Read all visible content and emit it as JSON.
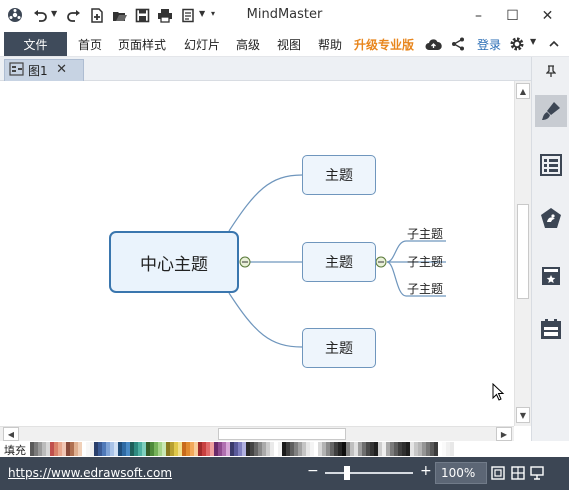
{
  "app": {
    "title": "MindMaster"
  },
  "toolbar": {
    "icons": [
      "app-logo-icon",
      "undo-icon",
      "redo-icon",
      "new-icon",
      "open-icon",
      "save-icon",
      "print-icon",
      "export-icon",
      "customize-icon"
    ]
  },
  "window_controls": {
    "minimize": "–",
    "maximize": "☐",
    "close": "✕"
  },
  "menu": {
    "file": "文件",
    "items": [
      "首页",
      "页面样式",
      "幻灯片",
      "高级",
      "视图",
      "帮助"
    ],
    "upgrade": "升级专业版",
    "login": "登录"
  },
  "tab": {
    "label": "图1",
    "close": "✕"
  },
  "mindmap": {
    "central": "中心主题",
    "topics": [
      "主题",
      "主题",
      "主题"
    ],
    "subtopics": [
      "子主题",
      "子主题",
      "子主题"
    ]
  },
  "right_panel": {
    "items": [
      "format-brush-icon",
      "outline-list-icon",
      "clipart-icon",
      "mark-icon",
      "task-calendar-icon"
    ]
  },
  "palette": {
    "fill_label": "填充",
    "colors": [
      "#5a5a5a",
      "#7a7a7a",
      "#9a9a9a",
      "#bbbbbb",
      "#d8d8d8",
      "#c0504d",
      "#d9826a",
      "#e9a88e",
      "#f2c6b4",
      "#8a4a3a",
      "#b07050",
      "#e0b090",
      "#f0d0b8",
      "#fff",
      "#f7f7f7",
      "#eeeeee",
      "#2a3f6b",
      "#3a5a94",
      "#4f79b8",
      "#7fa3d6",
      "#a9c3e8",
      "#d0e0f4",
      "#1f4d7a",
      "#2e6aa3",
      "#4a8bc6",
      "#1e5f5a",
      "#2e8a80",
      "#4eb0a2",
      "#7fcfbe",
      "#355e2a",
      "#4e8a3a",
      "#76b35a",
      "#a6d48a",
      "#c9e8b5",
      "#8a7a20",
      "#b8a030",
      "#e0c84a",
      "#f2e08a",
      "#c86a1a",
      "#e08a2e",
      "#f2a85a",
      "#f8cc9a",
      "#a02a2a",
      "#c84040",
      "#e06a6a",
      "#f0a0a0",
      "#6a2a6a",
      "#8e4a8e",
      "#b070b0",
      "#d8a8d8",
      "#3a3a6a",
      "#5a5a9a",
      "#8080c0",
      "#b0b0e0",
      "#2a2a2a",
      "#444444",
      "#666666",
      "#888888",
      "#aaaaaa",
      "#cccccc",
      "#eaeaea",
      "#fff",
      "#f2f2f2",
      "#1a1a1a",
      "#3c3c3c",
      "#5e5e5e",
      "#808080",
      "#a2a2a2",
      "#c4c4c4",
      "#e6e6e6",
      "#f4f4f4",
      "#ffffff",
      "#d9d9d9",
      "#b3b3b3",
      "#8c8c8c",
      "#666666",
      "#404040",
      "#262626",
      "#0d0d0d",
      "#7f7f7f",
      "#bfbfbf",
      "#e0e0e0",
      "#9e9e9e",
      "#6f6f6f",
      "#4a4a4a",
      "#353535",
      "#202020",
      "#cfcfcf",
      "#efefef",
      "#a9a9a9",
      "#7b7b7b",
      "#5d5d5d",
      "#3f3f3f",
      "#2f2f2f",
      "#1f1f1f",
      "#e5e5e5",
      "#c7c7c7",
      "#b5b5b5",
      "#959595",
      "#777777",
      "#595959",
      "#3b3b3b",
      "#ffffff",
      "#fafafa",
      "#f0f0f0",
      "#e8e8e8"
    ]
  },
  "status": {
    "url": "https://www.edrawsoft.com",
    "zoom_minus": "−",
    "zoom_plus": "+",
    "zoom_level": "100%",
    "zoom_fraction": 0.25
  },
  "colors": {
    "accent": "#3a76ae",
    "menu_dark": "#3f4b5b",
    "status_bg": "#3c4654",
    "upgrade": "#e8861d",
    "login": "#2a6db5"
  }
}
